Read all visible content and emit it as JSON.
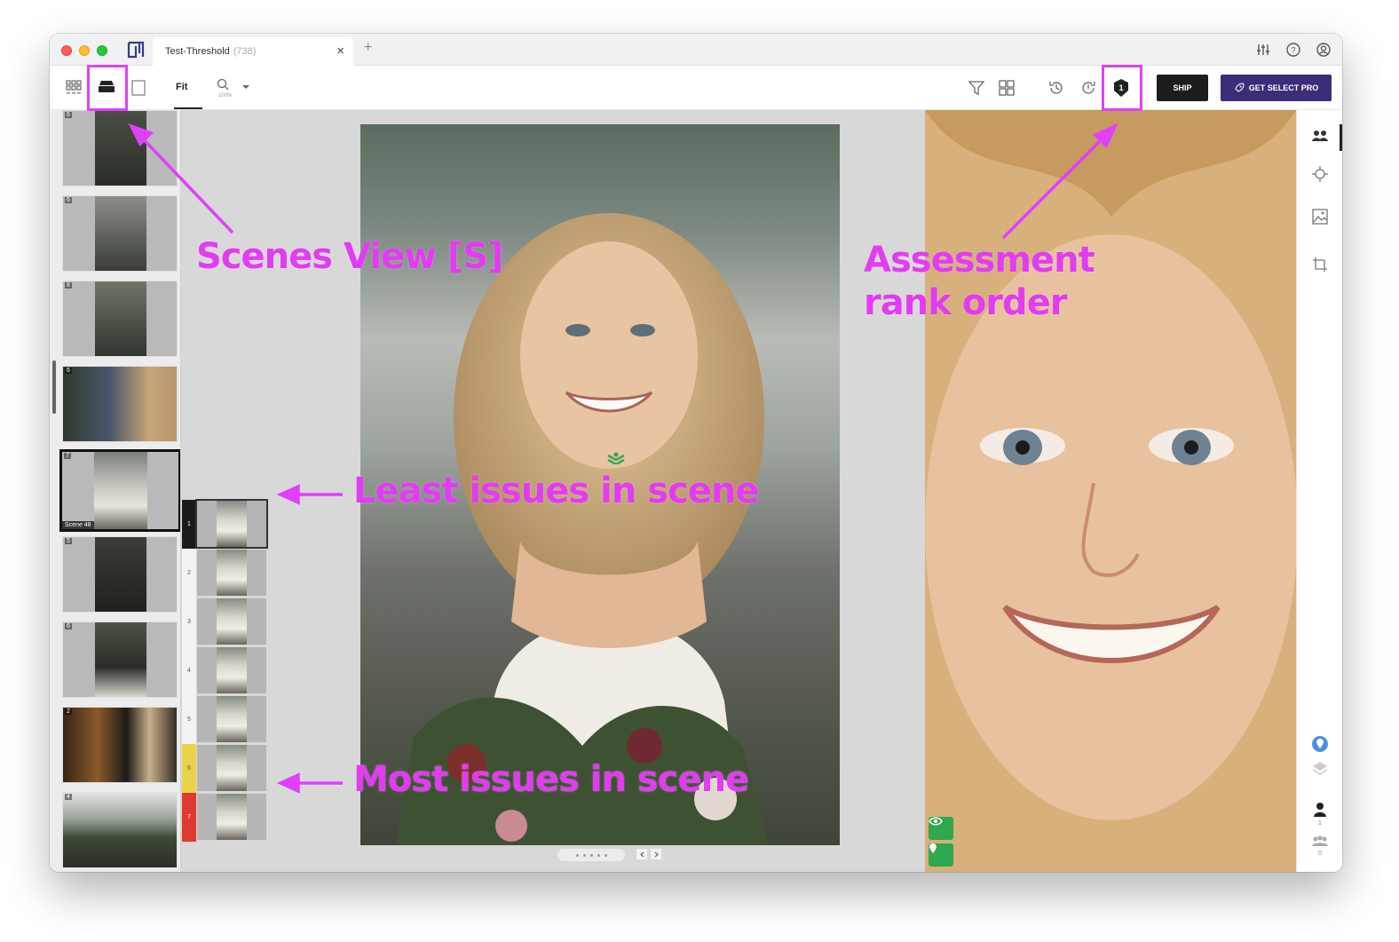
{
  "window": {
    "tab": {
      "title": "Test-Threshold",
      "count": "(738)"
    },
    "tab_add": "+",
    "tab_close": "×"
  },
  "toolbar": {
    "fit_label": "Fit",
    "zoom_percent": "100%",
    "ship_label": "SHIP",
    "pro_label": "GET SELECT PRO"
  },
  "sidebar": {
    "scenes": [
      {
        "count": "6"
      },
      {
        "count": "6"
      },
      {
        "count": "8"
      },
      {
        "count": "6"
      },
      {
        "count": "7",
        "active": true,
        "label": "Scene 48"
      },
      {
        "count": "5"
      },
      {
        "count": "6"
      },
      {
        "count": "2"
      },
      {
        "count": "4"
      }
    ]
  },
  "rank_strip": {
    "items": [
      {
        "rank": "1",
        "status": "best"
      },
      {
        "rank": "2",
        "status": "normal"
      },
      {
        "rank": "3",
        "status": "normal"
      },
      {
        "rank": "4",
        "status": "normal"
      },
      {
        "rank": "5",
        "status": "normal"
      },
      {
        "rank": "6",
        "status": "warning"
      },
      {
        "rank": "7",
        "status": "bad"
      }
    ]
  },
  "right_rail": {
    "faces_count": "1",
    "group_count": "0"
  },
  "annotations": {
    "scenes_view": "Scenes View [S]",
    "assessment_line1": "Assessment",
    "assessment_line2": "rank order",
    "least_issues": "Least issues in scene",
    "most_issues": "Most issues in scene"
  },
  "colors": {
    "annotation": "#e040fb",
    "ship_bg": "#1d1d1f",
    "pro_bg": "#3d2d78",
    "best_rank": "#1b1b1b",
    "warning_rank": "#ecd44a",
    "bad_rank": "#dd3b31",
    "focus_green": "#2fa84f"
  },
  "icons": {
    "grid_view": "grid-view-icon",
    "scenes_view": "scenes-view-icon",
    "single_view": "single-view-icon",
    "zoom": "magnifier-icon",
    "filter": "filter-icon",
    "compare": "compare-icon",
    "history": "history-icon",
    "redo_history": "history-forward-icon",
    "assessment": "assessment-rank-icon",
    "settings": "sliders-icon",
    "help": "help-icon",
    "account": "account-icon"
  }
}
